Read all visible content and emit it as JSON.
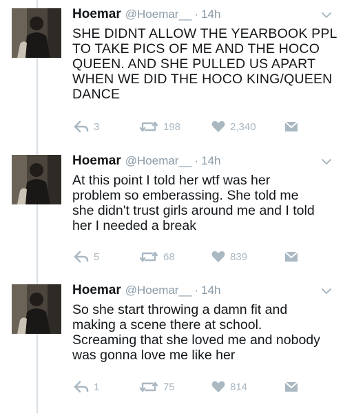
{
  "colors": {
    "name": "#14171a",
    "muted": "#8899a6",
    "action_icon": "#aab8c2",
    "thread_line": "#d8dee3"
  },
  "tweets": [
    {
      "name": "Hoemar",
      "handle": "@Hoemar__",
      "separator": "·",
      "time": "14h",
      "text_lines": [
        "SHE DIDNT ALLOW THE YEARBOOK PPL",
        "TO TAKE PICS OF ME AND THE HOCO",
        "QUEEN. AND SHE PULLED US APART",
        "WHEN WE DID THE HOCO KING/QUEEN",
        "DANCE"
      ],
      "replies": "3",
      "retweets": "198",
      "likes": "2,340"
    },
    {
      "name": "Hoemar",
      "handle": "@Hoemar__",
      "separator": "·",
      "time": "14h",
      "text_lines": [
        "At this point I told her wtf was her",
        "problem so emberassing. She told me",
        "she didn't trust girls around me and I told",
        "her I needed a break"
      ],
      "replies": "5",
      "retweets": "68",
      "likes": "839"
    },
    {
      "name": "Hoemar",
      "handle": "@Hoemar__",
      "separator": "·",
      "time": "14h",
      "text_lines": [
        "So she start throwing a damn fit and",
        "making a scene there at school.",
        "Screaming that she loved me and nobody",
        "was gonna love me like her"
      ],
      "replies": "1",
      "retweets": "75",
      "likes": "814"
    }
  ],
  "icons": {
    "reply": "reply-icon",
    "retweet": "retweet-icon",
    "like": "heart-icon",
    "dm": "envelope-icon",
    "more": "chevron-down-icon"
  }
}
